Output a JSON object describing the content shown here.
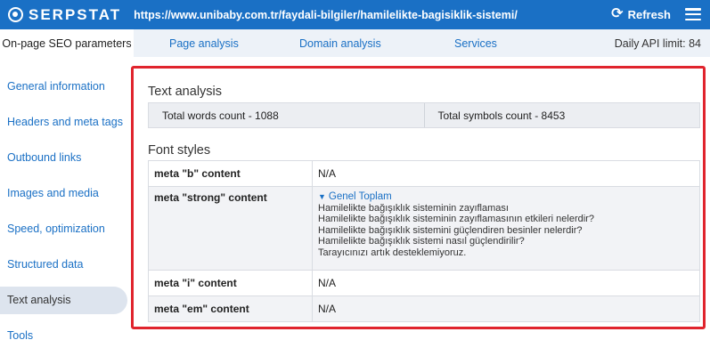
{
  "topbar": {
    "logo_text": "SERPSTAT",
    "url": "https://www.unibaby.com.tr/faydali-bilgiler/hamilelikte-bagisiklik-sistemi/",
    "refresh_label": "Refresh",
    "color": "#1a70c5"
  },
  "tabs": {
    "active": "On-page SEO parameters",
    "items": [
      "Page analysis",
      "Domain analysis",
      "Services"
    ],
    "api_limit": "Daily API limit: 84"
  },
  "sidebar": {
    "items": [
      "General information",
      "Headers and meta tags",
      "Outbound links",
      "Images and media",
      "Speed, optimization",
      "Structured data",
      "Text analysis",
      "Tools"
    ],
    "active_index": 6
  },
  "text_analysis": {
    "title": "Text analysis",
    "words": "Total words count - 1088",
    "symbols": "Total symbols count - 8453"
  },
  "font_styles": {
    "title": "Font styles",
    "rows": [
      {
        "key": "meta \"b\" content",
        "value": "N/A"
      },
      {
        "key": "meta \"strong\" content",
        "toggle": "Genel Toplam",
        "lines": [
          "Hamilelikte bağışıklık sisteminin zayıflaması",
          "Hamilelikte bağışıklık sisteminin zayıflamasının etkileri nelerdir?",
          "Hamilelikte bağışıklık sistemini güçlendiren besinler nelerdir?",
          "Hamilelikte bağışıklık sistemi nasıl güçlendirilir?",
          "Tarayıcınızı artık desteklemiyoruz."
        ]
      },
      {
        "key": "meta \"i\" content",
        "value": "N/A"
      },
      {
        "key": "meta \"em\" content",
        "value": "N/A"
      }
    ]
  },
  "highlight_color": "#e0242d"
}
